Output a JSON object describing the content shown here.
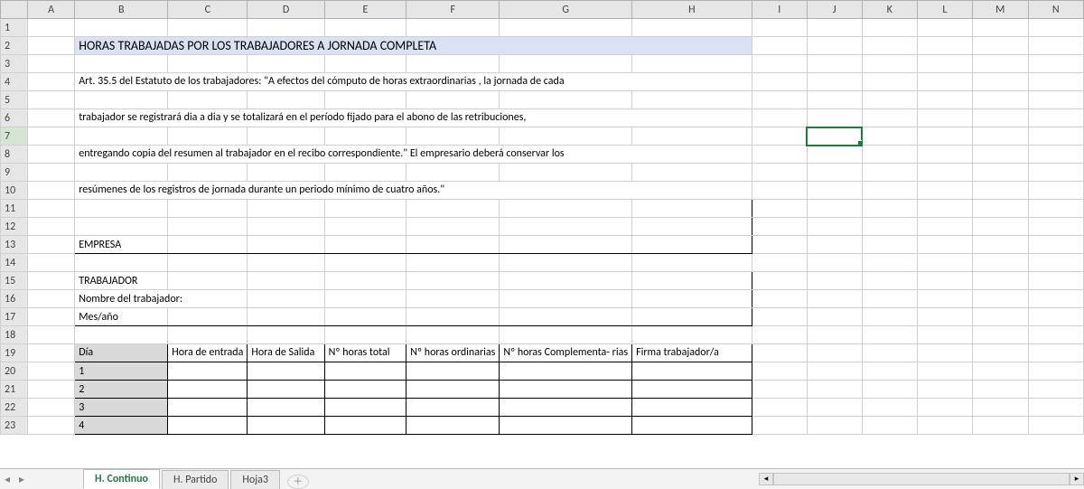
{
  "columns": [
    "A",
    "B",
    "C",
    "D",
    "E",
    "F",
    "G",
    "H",
    "I",
    "J",
    "K",
    "L",
    "M",
    "N"
  ],
  "rows_visible": 23,
  "selected_cell": "J7",
  "title": "HORAS TRABAJADAS POR LOS TRABAJADORES A JORNADA COMPLETA",
  "paragraph_lines": [
    "Art. 35.5 del Estatuto de los trabajadores:  \"A efectos del cómputo  de horas extraordinarias , la jornada de cada",
    "trabajador se registrará dia a dia y se totalizará en el período fijado para el abono de las retribuciones,",
    "entregando copia del resumen al trabajador en el recibo correspondiente.\" El empresario deberá conservar los",
    "resúmenes de los registros de jornada durante un periodo mínimo de cuatro años.\""
  ],
  "form": {
    "empresa_label": "EMPRESA",
    "trabajador_label": "TRABAJADOR",
    "nombre_label": "Nombre del trabajador:",
    "mesano_label": "Mes/año"
  },
  "table": {
    "headers": [
      "Día",
      "Hora de entrada",
      "Hora de Salida",
      "Nº horas total",
      "Nº horas ordinarias",
      "Nº horas Complementa- rias",
      "Firma trabajador/a"
    ],
    "rows": [
      "1",
      "2",
      "3",
      "4"
    ]
  },
  "sheet_tabs": [
    "H. Continuo",
    "H. Partido",
    "Hoja3"
  ],
  "active_tab": 0
}
